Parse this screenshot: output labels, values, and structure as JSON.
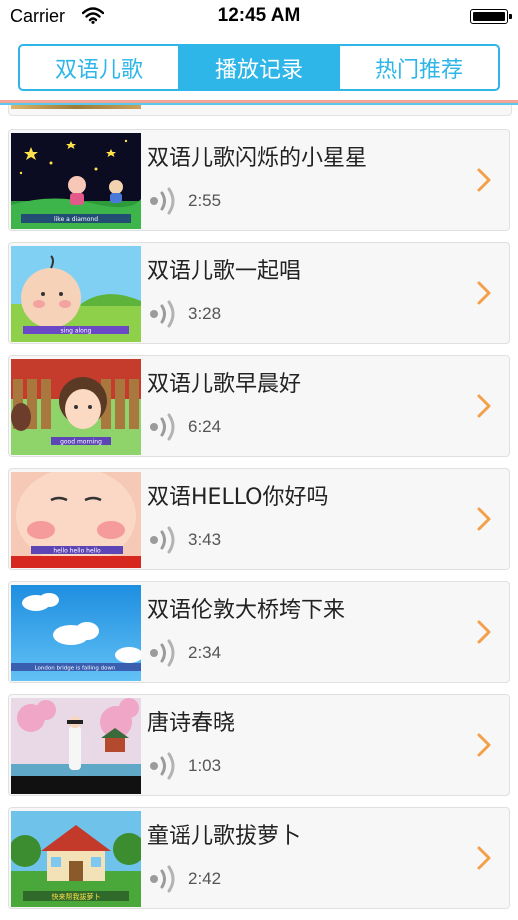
{
  "status_bar": {
    "carrier": "Carrier",
    "time": "12:45 AM"
  },
  "tabs": [
    {
      "label": "双语儿歌",
      "active": false
    },
    {
      "label": "播放记录",
      "active": true
    },
    {
      "label": "热门推荐",
      "active": false
    }
  ],
  "colors": {
    "accent": "#2eb6e8",
    "chevron": "#f4a04a",
    "card_bg": "#f7f7f7"
  },
  "items": [
    {
      "title": "双语儿歌闪烁的小星星",
      "duration": "2:55",
      "thumb_caption": "like a diamond"
    },
    {
      "title": "双语儿歌一起唱",
      "duration": "3:28",
      "thumb_caption": "sing along"
    },
    {
      "title": "双语儿歌早晨好",
      "duration": "6:24",
      "thumb_caption": "good morning"
    },
    {
      "title": "双语HELLO你好吗",
      "duration": "3:43",
      "thumb_caption": "hello hello hello"
    },
    {
      "title": "双语伦敦大桥垮下来",
      "duration": "2:34",
      "thumb_caption": "London bridge is falling down"
    },
    {
      "title": "唐诗春晓",
      "duration": "1:03",
      "thumb_caption": ""
    },
    {
      "title": "童谣儿歌拔萝卜",
      "duration": "2:42",
      "thumb_caption": "快来帮我拔萝卜"
    }
  ]
}
